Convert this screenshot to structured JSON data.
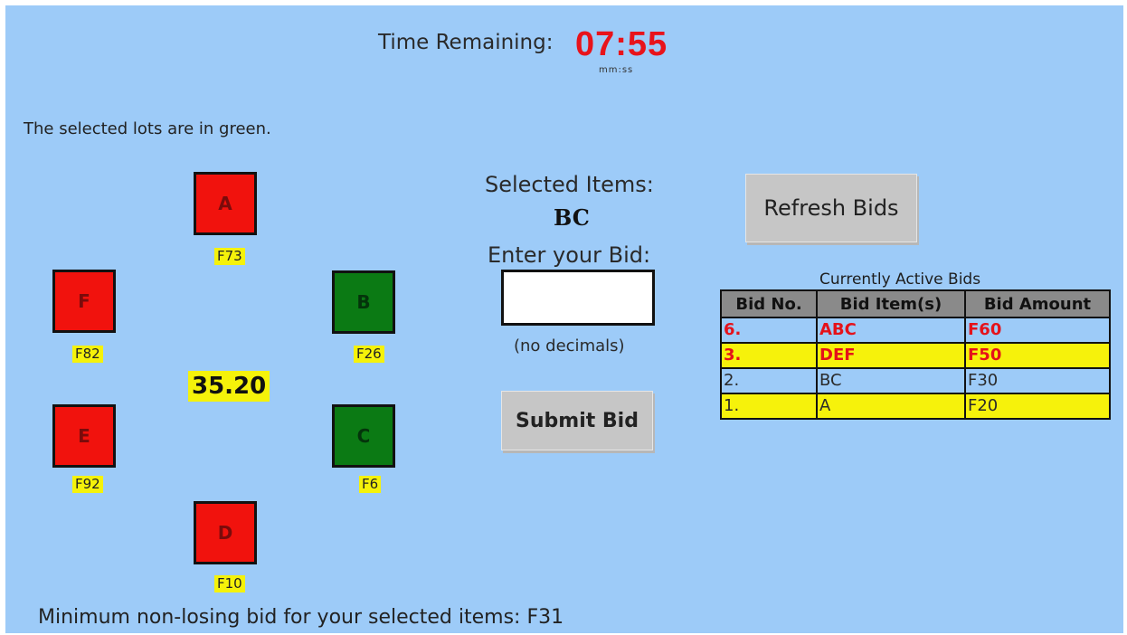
{
  "timer": {
    "label": "Time Remaining:",
    "value": "07:55",
    "unit": "mm:ss"
  },
  "instruction": "The selected lots are in green.",
  "lots": {
    "A": {
      "label": "A",
      "price": "F73",
      "selected": false
    },
    "B": {
      "label": "B",
      "price": "F26",
      "selected": true
    },
    "C": {
      "label": "C",
      "price": "F6",
      "selected": true
    },
    "D": {
      "label": "D",
      "price": "F10",
      "selected": false
    },
    "E": {
      "label": "E",
      "price": "F92",
      "selected": false
    },
    "F": {
      "label": "F",
      "price": "F82",
      "selected": false
    }
  },
  "center_value": "35.20",
  "selection": {
    "label": "Selected Items:",
    "value": "BC",
    "bid_label": "Enter your Bid:",
    "bid_value": "",
    "bid_hint": "(no decimals)",
    "submit_label": "Submit Bid"
  },
  "refresh_label": "Refresh Bids",
  "bids": {
    "title": "Currently Active Bids",
    "headers": [
      "Bid No.",
      "Bid Item(s)",
      "Bid Amount"
    ],
    "rows": [
      {
        "no": "6.",
        "items": "ABC",
        "amount": "F60"
      },
      {
        "no": "3.",
        "items": "DEF",
        "amount": "F50"
      },
      {
        "no": "2.",
        "items": "BC",
        "amount": "F30"
      },
      {
        "no": "1.",
        "items": "A",
        "amount": "F20"
      }
    ]
  },
  "min_bid_text": "Minimum non-losing bid for your selected items: F31",
  "colors": {
    "background": "#9dcbf8",
    "unselected_lot": "#f1120d",
    "selected_lot": "#0b7a14",
    "price_tag": "#f5f20a",
    "timer": "#e8131b",
    "highlight_bid": "#e5121a"
  }
}
